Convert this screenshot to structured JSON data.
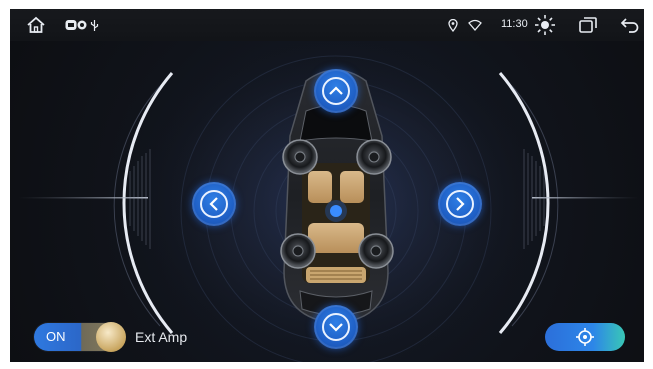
{
  "status_bar": {
    "time": "11:30",
    "icons": [
      "home-icon",
      "screen-link-icon",
      "usb-icon",
      "location-icon",
      "wifi-icon",
      "brightness-icon",
      "recent-apps-icon",
      "back-icon"
    ]
  },
  "controls": {
    "amp_toggle_label": "ON",
    "amp_label": "Ext Amp"
  },
  "colors": {
    "accent_blue": "#2f7fe6",
    "background": "#0d0f13",
    "toggle_knob": "#c9a660",
    "center_button_end": "#39c7b6"
  }
}
